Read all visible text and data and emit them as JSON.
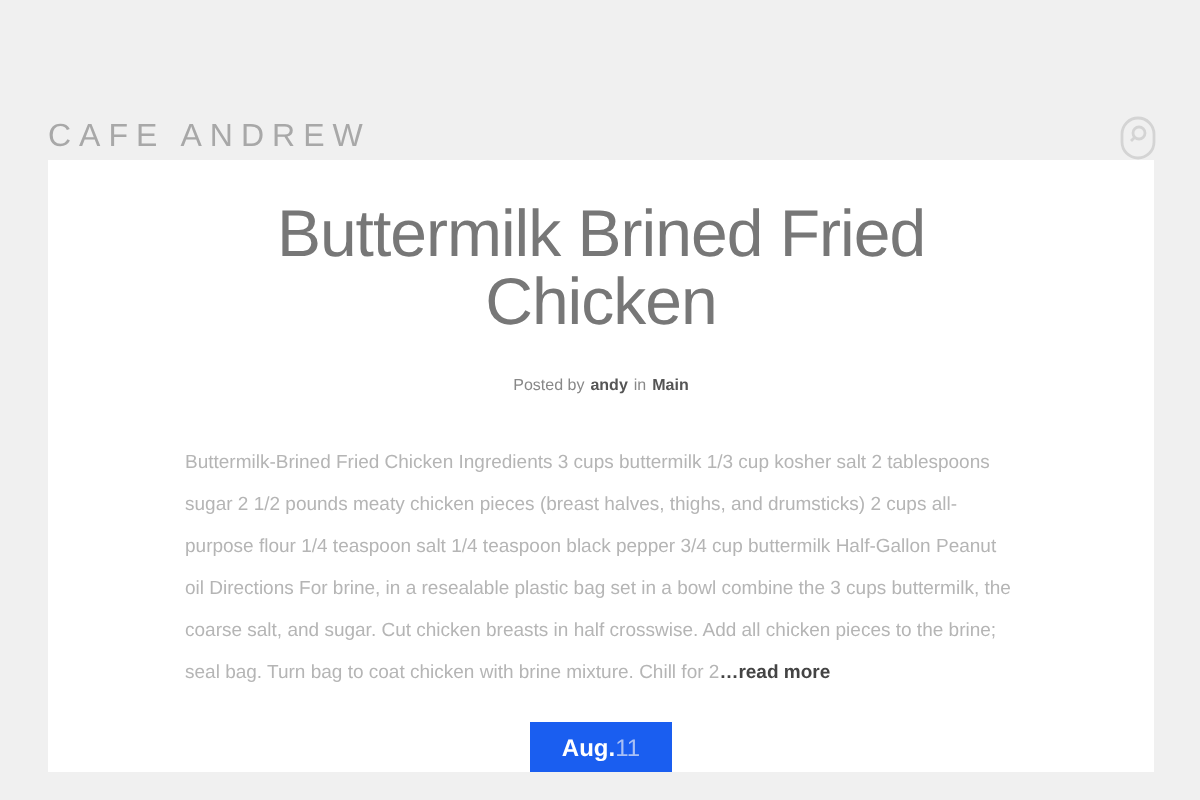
{
  "site_title": "CAFE ANDREW",
  "post": {
    "title": "Buttermilk Brined Fried Chicken",
    "meta": {
      "prefix": "Posted by",
      "author": "andy",
      "joiner": "in",
      "category": "Main"
    },
    "excerpt": "Buttermilk-Brined Fried Chicken Ingredients 3 cups buttermilk 1/3 cup kosher salt 2 tablespoons sugar 2 1/2 pounds meaty chicken pieces (breast halves, thighs, and drumsticks) 2 cups all-purpose flour 1/4 teaspoon salt 1/4 teaspoon black pepper 3/4 cup buttermilk Half-Gallon Peanut oil Directions For brine, in a resealable plastic bag set in a bowl combine the 3 cups buttermilk, the coarse salt, and sugar. Cut chicken breasts in half crosswise. Add all chicken pieces to the brine; seal bag. Turn bag to coat chicken with brine mixture. Chill for 2",
    "read_more": "…read more",
    "date": {
      "month": "Aug.",
      "day": "11"
    }
  }
}
